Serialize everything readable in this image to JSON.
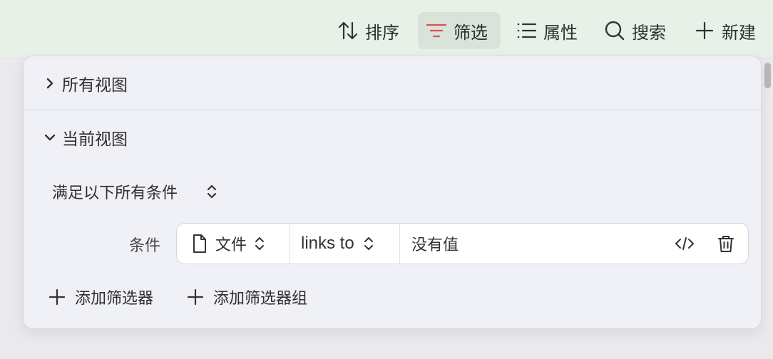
{
  "toolbar": {
    "sort_label": "排序",
    "filter_label": "筛选",
    "properties_label": "属性",
    "search_label": "搜索",
    "new_label": "新建"
  },
  "panel": {
    "all_views_label": "所有视图",
    "current_view_label": "当前视图",
    "match_mode": "满足以下所有条件",
    "condition_label": "条件",
    "condition": {
      "property": "文件",
      "operator": "links to",
      "value": "没有值"
    },
    "add_filter_label": "添加筛选器",
    "add_filter_group_label": "添加筛选器组"
  },
  "colors": {
    "topbar_bg": "#e7f1e8",
    "panel_bg": "#f0f0f7",
    "filter_icon_accent": "#d9534f"
  },
  "icons": {
    "sort": "sort-arrows-icon",
    "filter": "filter-lines-icon",
    "properties": "list-icon",
    "search": "search-icon",
    "new": "plus-icon",
    "file": "file-icon",
    "code": "code-icon",
    "delete": "trash-icon"
  }
}
